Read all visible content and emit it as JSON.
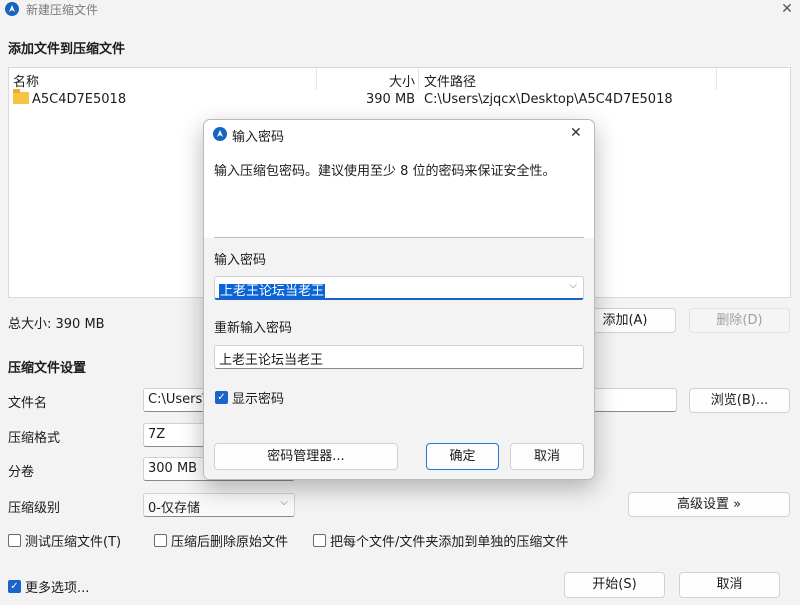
{
  "window": {
    "title": "新建压缩文件",
    "close_glyph": "✕"
  },
  "add_section": {
    "title": "添加文件到压缩文件"
  },
  "file_list": {
    "columns": [
      "名称",
      "大小",
      "文件路径"
    ],
    "rows": [
      {
        "name": "A5C4D7E5018",
        "size": "390 MB",
        "path": "C:\\Users\\zjqcx\\Desktop\\A5C4D7E5018"
      }
    ]
  },
  "total": {
    "label": "总大小: 390 MB"
  },
  "list_buttons": {
    "add": "添加(A)",
    "delete": "删除(D)"
  },
  "settings": {
    "title": "压缩文件设置",
    "filename_label": "文件名",
    "filename_value": "C:\\Users\\",
    "browse": "浏览(B)...",
    "format_label": "压缩格式",
    "format_value": "7Z",
    "volume_label": "分卷",
    "volume_value": "300 MB",
    "level_label": "压缩级别",
    "level_value": "0-仅存储",
    "advanced": "高级设置 »"
  },
  "options": {
    "test": "测试压缩文件(T)",
    "delete_after": "压缩后删除原始文件",
    "separate": "把每个文件/文件夹添加到单独的压缩文件",
    "more": "更多选项..."
  },
  "footer": {
    "start": "开始(S)",
    "cancel": "取消"
  },
  "dialog": {
    "title": "输入密码",
    "close_glyph": "✕",
    "hint": "输入压缩包密码。建议使用至少 8 位的密码来保证安全性。",
    "password_label": "输入密码",
    "password_value": "上老王论坛当老王",
    "reenter_label": "重新输入密码",
    "reenter_value": "上老王论坛当老王",
    "show_password": "显示密码",
    "manager": "密码管理器...",
    "ok": "确定",
    "cancel": "取消"
  },
  "colors": {
    "accent": "#1a63c9",
    "selection": "#0a64d6",
    "folder": "#f6c343"
  }
}
